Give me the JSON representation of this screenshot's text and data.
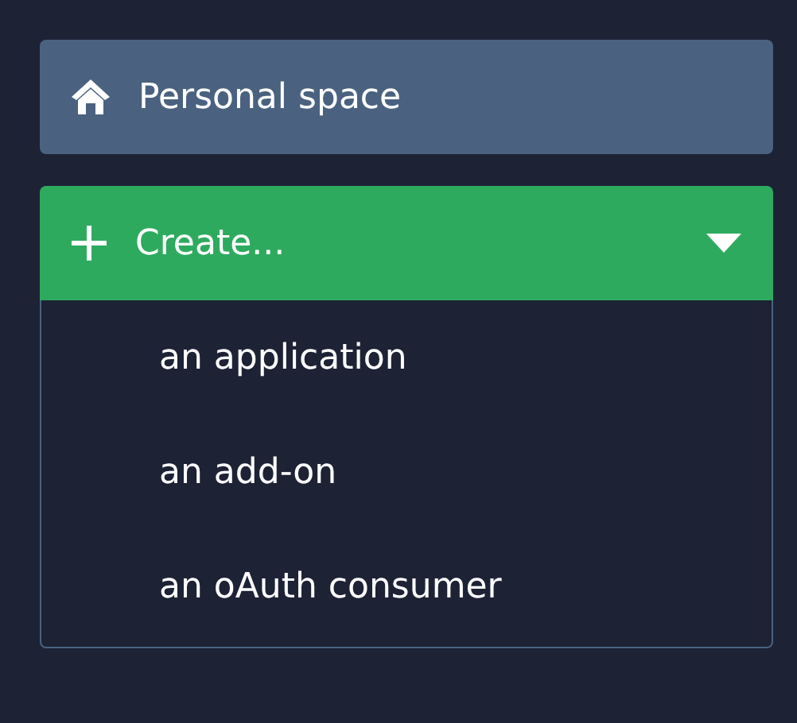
{
  "personal_space": {
    "label": "Personal space"
  },
  "create_menu": {
    "label": "Create...",
    "expanded": true,
    "items": [
      {
        "label": "an application"
      },
      {
        "label": "an add-on"
      },
      {
        "label": "an oAuth consumer"
      }
    ]
  }
}
